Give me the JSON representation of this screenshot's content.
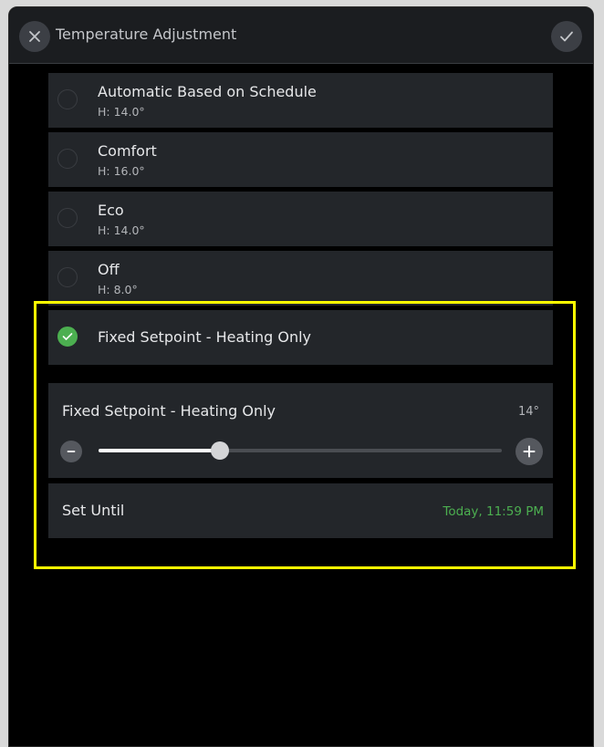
{
  "header": {
    "title": "Temperature Adjustment",
    "close_icon": "close-icon",
    "confirm_icon": "check-icon"
  },
  "modes": [
    {
      "name": "Automatic Based on Schedule",
      "sub": "H: 14.0°",
      "selected": false
    },
    {
      "name": "Comfort",
      "sub": "H: 16.0°",
      "selected": false
    },
    {
      "name": "Eco",
      "sub": "H: 14.0°",
      "selected": false
    },
    {
      "name": "Off",
      "sub": "H: 8.0°",
      "selected": false
    },
    {
      "name": "Fixed Setpoint - Heating Only",
      "selected": true
    }
  ],
  "setpoint": {
    "title": "Fixed Setpoint - Heating Only",
    "value_label": "14°",
    "level_fraction": 0.3,
    "minus_icon": "minus-icon",
    "plus_icon": "plus-icon"
  },
  "set_until": {
    "label": "Set Until",
    "value": "Today, 11:59 PM"
  },
  "colors": {
    "accent_green": "#4caf50",
    "highlight": "#ffff00",
    "card_bg": "#23262a"
  }
}
